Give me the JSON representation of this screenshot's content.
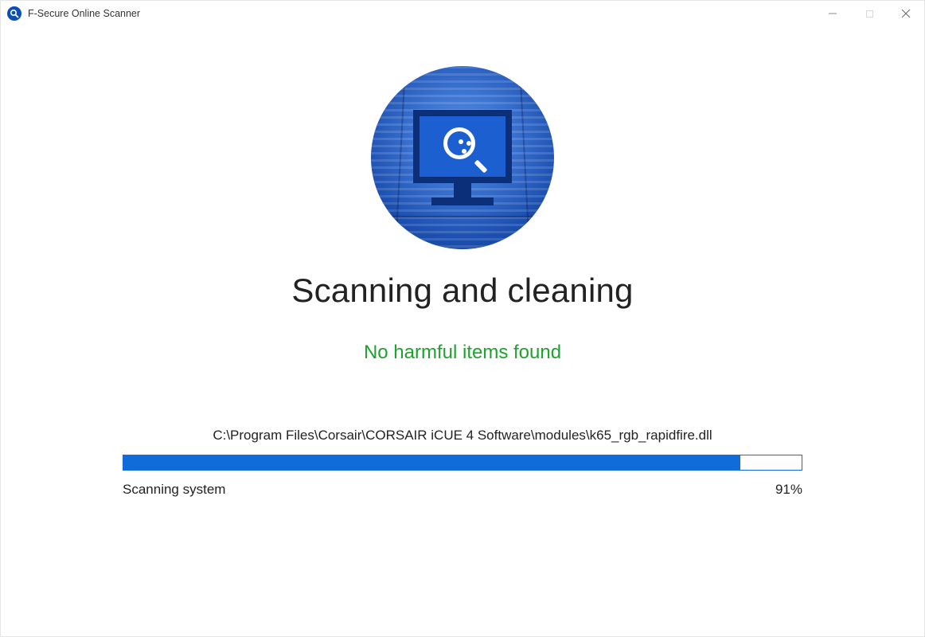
{
  "window": {
    "title": "F-Secure Online Scanner"
  },
  "main": {
    "heading": "Scanning and cleaning",
    "status_message": "No harmful items found"
  },
  "scan": {
    "current_file": "C:\\Program Files\\Corsair\\CORSAIR iCUE 4 Software\\modules\\k65_rgb_rapidfire.dll",
    "task_label": "Scanning system",
    "percent_label": "91%",
    "percent_value": 91
  },
  "colors": {
    "accent": "#0f6cd8",
    "success": "#1fa12e"
  }
}
